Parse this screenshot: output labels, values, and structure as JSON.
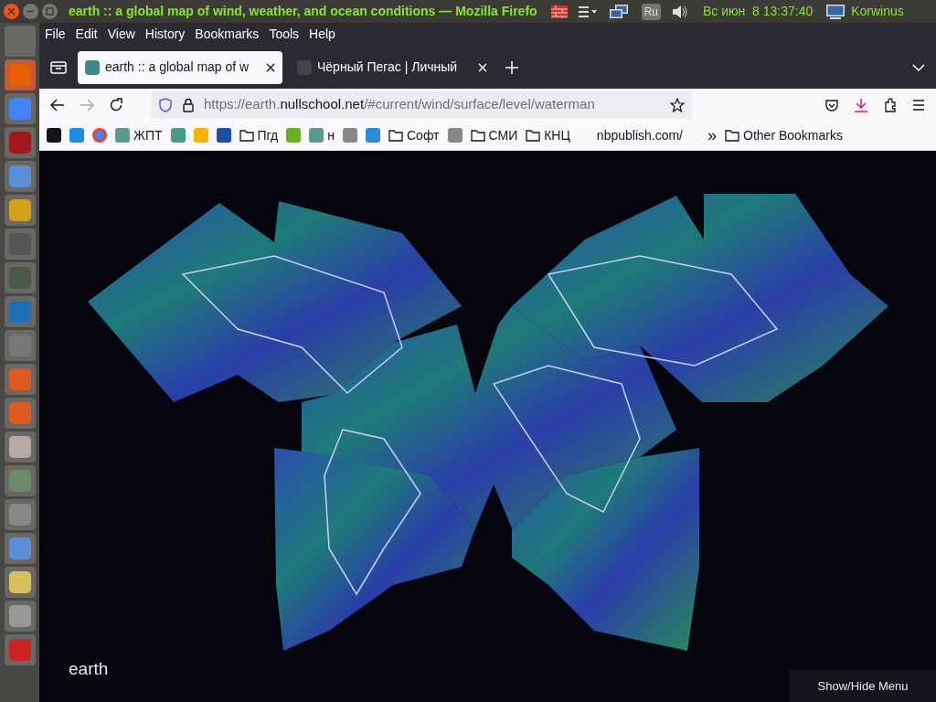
{
  "top_panel": {
    "window_title": "earth :: a global map of wind, weather, and ocean conditions — Mozilla Firefo",
    "keyboard_layout": "Ru",
    "clock": "Вс июн  8 13:37:40",
    "user": "Korwinus"
  },
  "menu_bar": [
    "File",
    "Edit",
    "View",
    "History",
    "Bookmarks",
    "Tools",
    "Help"
  ],
  "tabs": [
    {
      "title": "earth :: a global map of w",
      "selected": true
    },
    {
      "title": "Чёрный Пегас | Личный",
      "selected": false
    }
  ],
  "address_bar": {
    "url_prefix": "https://earth.",
    "url_domain": "nullschool.net",
    "url_suffix": "/#current/wind/surface/level/waterman"
  },
  "bookmarks": [
    {
      "kind": "icon"
    },
    {
      "kind": "icon"
    },
    {
      "kind": "icon"
    },
    {
      "kind": "site",
      "label": "ЖПТ"
    },
    {
      "kind": "icon"
    },
    {
      "kind": "icon"
    },
    {
      "kind": "icon"
    },
    {
      "kind": "folder",
      "label": "Пгд"
    },
    {
      "kind": "icon"
    },
    {
      "kind": "site",
      "label": "н"
    },
    {
      "kind": "icon"
    },
    {
      "kind": "icon"
    },
    {
      "kind": "folder",
      "label": "Софт"
    },
    {
      "kind": "icon"
    },
    {
      "kind": "folder",
      "label": "СМИ"
    },
    {
      "kind": "folder",
      "label": "КНЦ"
    },
    {
      "kind": "text",
      "label": "nbpublish.com/"
    },
    {
      "kind": "chevron",
      "label": "»"
    },
    {
      "kind": "folder",
      "label": "Other Bookmarks"
    }
  ],
  "page": {
    "logo": "earth",
    "menu_button": "Show/Hide Menu"
  }
}
